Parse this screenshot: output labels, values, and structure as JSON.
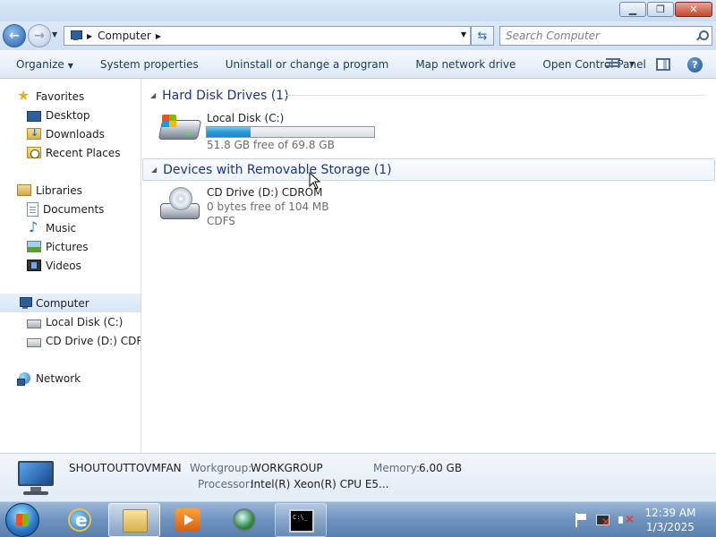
{
  "window": {
    "minimize_glyph": "▁",
    "restore_glyph": "❐",
    "close_glyph": "✕"
  },
  "address": {
    "breadcrumb": "Computer",
    "search_placeholder": "Search Computer"
  },
  "toolbar": {
    "organize": "Organize",
    "system_properties": "System properties",
    "uninstall": "Uninstall or change a program",
    "map_drive": "Map network drive",
    "control_panel": "Open Control Panel",
    "help": "?"
  },
  "nav": {
    "favorites": "Favorites",
    "desktop": "Desktop",
    "downloads": "Downloads",
    "recent": "Recent Places",
    "libraries": "Libraries",
    "documents": "Documents",
    "music": "Music",
    "pictures": "Pictures",
    "videos": "Videos",
    "computer": "Computer",
    "local_disk": "Local Disk (C:)",
    "cd_drive": "CD Drive (D:) CDROM",
    "network": "Network"
  },
  "groups": {
    "hdd": "Hard Disk Drives (1)",
    "removable": "Devices with Removable Storage (1)"
  },
  "drives": {
    "c": {
      "name": "Local Disk (C:)",
      "space": "51.8 GB free of 69.8 GB",
      "used_fraction": 0.26
    },
    "d": {
      "name": "CD Drive (D:) CDROM",
      "space": "0 bytes free of 104 MB",
      "fs": "CDFS"
    }
  },
  "details": {
    "computer_name": "SHOUTOUTTOVMFAN",
    "workgroup_label": "Workgroup:",
    "workgroup_value": "WORKGROUP",
    "memory_label": "Memory:",
    "memory_value": "6.00 GB",
    "processor_label": "Processor:",
    "processor_value": "Intel(R) Xeon(R) CPU E5..."
  },
  "taskbar": {
    "time": "12:39 AM",
    "date": "1/3/2025"
  }
}
